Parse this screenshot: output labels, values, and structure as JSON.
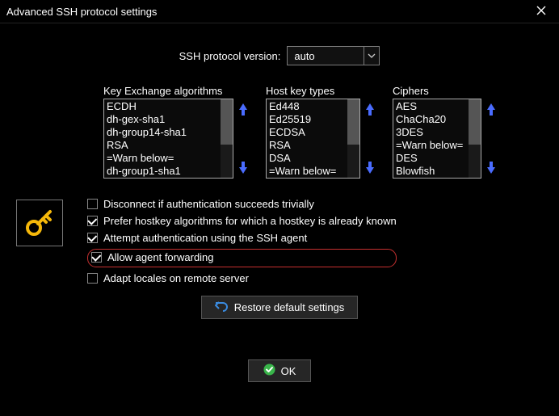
{
  "window": {
    "title": "Advanced SSH protocol settings"
  },
  "version": {
    "label": "SSH protocol version:",
    "value": "auto"
  },
  "lists": {
    "kex": {
      "header": "Key Exchange algorithms",
      "items": [
        "ECDH",
        "dh-gex-sha1",
        "dh-group14-sha1",
        "RSA",
        "=Warn below=",
        "dh-group1-sha1"
      ]
    },
    "host": {
      "header": "Host key types",
      "items": [
        "Ed448",
        "Ed25519",
        "ECDSA",
        "RSA",
        "DSA",
        "=Warn below="
      ]
    },
    "ciphers": {
      "header": "Ciphers",
      "items": [
        "AES",
        "ChaCha20",
        "3DES",
        "=Warn below=",
        "DES",
        "Blowfish"
      ]
    }
  },
  "options": {
    "disconnect_trivial": {
      "label": "Disconnect if authentication succeeds trivially",
      "checked": false
    },
    "prefer_hostkey": {
      "label": "Prefer hostkey algorithms for which a hostkey is already known",
      "checked": true
    },
    "attempt_agent": {
      "label": "Attempt authentication using the SSH agent",
      "checked": true
    },
    "allow_forwarding": {
      "label": "Allow agent forwarding",
      "checked": true
    },
    "adapt_locales": {
      "label": "Adapt locales on remote server",
      "checked": false
    }
  },
  "buttons": {
    "restore": "Restore default settings",
    "ok": "OK"
  },
  "icons": {
    "key": "key-icon",
    "restore": "undo-icon",
    "ok": "check-icon",
    "close": "close-icon",
    "dropdown": "chevron-down-icon",
    "up": "arrow-up-icon",
    "down": "arrow-down-icon"
  }
}
